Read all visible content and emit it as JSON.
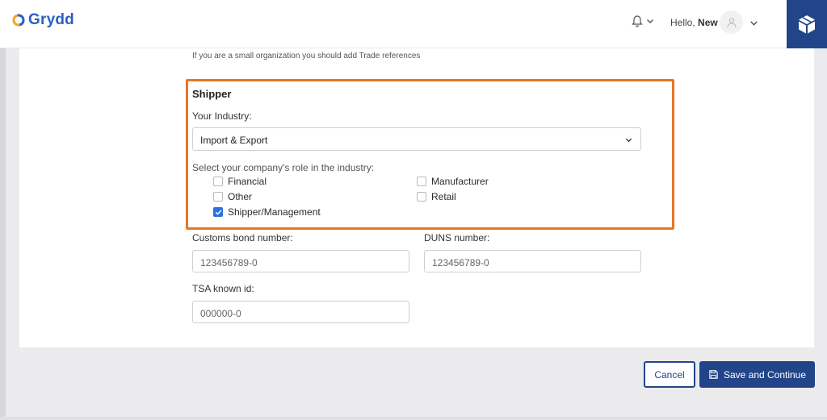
{
  "header": {
    "brand": "Grydd",
    "greeting_prefix": "Hello,",
    "user_name": "New"
  },
  "form": {
    "hint": "If you are a small organization you should add Trade references",
    "section_title": "Shipper",
    "industry_label": "Your Industry:",
    "industry_value": "Import & Export",
    "role_label": "Select your company's role in the industry:",
    "roles": [
      {
        "label": "Financial",
        "checked": false
      },
      {
        "label": "Manufacturer",
        "checked": false
      },
      {
        "label": "Other",
        "checked": false
      },
      {
        "label": "Retail",
        "checked": false
      },
      {
        "label": "Shipper/Management",
        "checked": true
      }
    ],
    "customs_label": "Customs bond number:",
    "customs_placeholder": "123456789-0",
    "duns_label": "DUNS number:",
    "duns_placeholder": "123456789-0",
    "tsa_label": "TSA known id:",
    "tsa_placeholder": "000000-0"
  },
  "actions": {
    "cancel_label": "Cancel",
    "save_label": "Save and Continue"
  },
  "colors": {
    "brand_blue": "#22458a",
    "highlight_orange": "#e87724",
    "checkbox_blue": "#2f6fe4"
  },
  "icons": [
    "grydd-logo-icon",
    "bell-icon",
    "chevron-down-icon",
    "user-icon",
    "box-icon",
    "save-icon",
    "check-icon"
  ]
}
